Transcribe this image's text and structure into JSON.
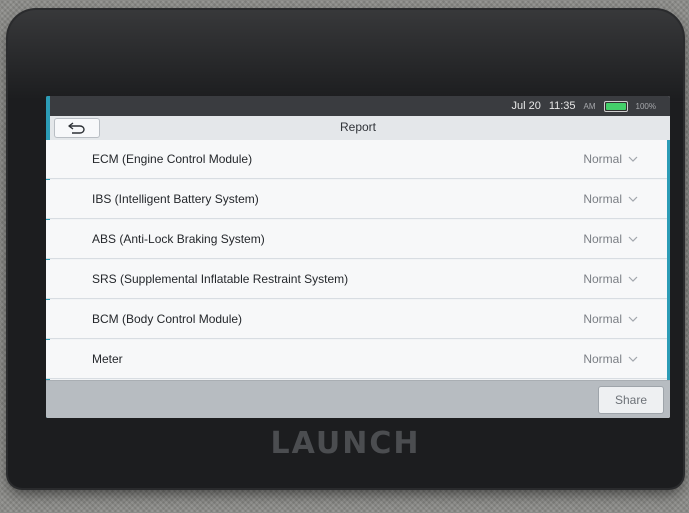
{
  "status_bar": {
    "date": "Jul 20",
    "time": "11:35",
    "ampm": "AM",
    "battery": "100%",
    "battery_level": 1.0
  },
  "header": {
    "title": "Report",
    "back_icon": "back-arrow-icon"
  },
  "rows": [
    {
      "label": "ECM (Engine Control Module)",
      "status": "Normal"
    },
    {
      "label": "IBS (Intelligent Battery System)",
      "status": "Normal"
    },
    {
      "label": "ABS (Anti-Lock Braking System)",
      "status": "Normal"
    },
    {
      "label": "SRS (Supplemental Inflatable Restraint System)",
      "status": "Normal"
    },
    {
      "label": "BCM (Body Control Module)",
      "status": "Normal"
    },
    {
      "label": "Meter",
      "status": "Normal"
    }
  ],
  "footer": {
    "share_label": "Share"
  },
  "device": {
    "brand": "LAUNCH"
  },
  "colors": {
    "accent": "#2c9cb6",
    "battery": "#44d06a"
  }
}
